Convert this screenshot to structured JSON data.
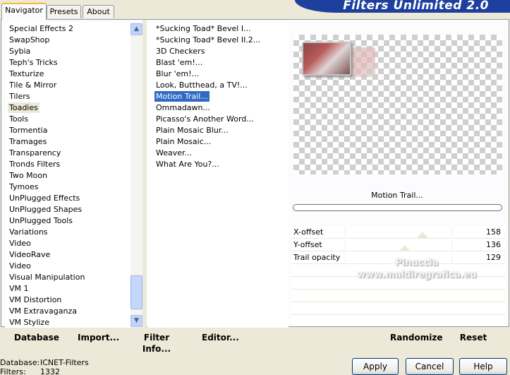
{
  "title": "Filters Unlimited 2.0",
  "tabs": [
    "Navigator",
    "Presets",
    "About"
  ],
  "categories": [
    "Special Effects 2",
    "SwapShop",
    "Sybia",
    "Teph's Tricks",
    "Texturize",
    "Tile & Mirror",
    "Tilers",
    "Toadies",
    "Tools",
    "Tormentia",
    "Tramages",
    "Transparency",
    "Tronds Filters",
    "Two Moon",
    "Tymoes",
    "UnPlugged Effects",
    "UnPlugged Shapes",
    "UnPlugged Tools",
    "Variations",
    "Video",
    "VideoRave",
    "Video",
    "Visual Manipulation",
    "VM 1",
    "VM Distortion",
    "VM Extravaganza",
    "VM Stylize"
  ],
  "selected_category": "Toadies",
  "filters": [
    "*Sucking Toad*  Bevel I...",
    "*Sucking Toad*  Bevel II.2...",
    "3D Checkers",
    "Blast 'em!...",
    "Blur 'em!...",
    "Look, Butthead, a TV!...",
    "Motion Trail...",
    "Ommadawn...",
    "Picasso's Another Word...",
    "Plain Mosaic Blur...",
    "Plain Mosaic...",
    "Weaver...",
    "What Are You?..."
  ],
  "selected_filter": "Motion Trail...",
  "filter_name": "Motion Trail...",
  "params": [
    {
      "label": "X-offset",
      "value": "158",
      "level": 158
    },
    {
      "label": "Y-offset",
      "value": "136",
      "level": 136
    },
    {
      "label": "Trail opacity",
      "value": "129",
      "level": 129
    }
  ],
  "watermark": [
    "Pinuccia",
    "www.maldiregrafica.eu"
  ],
  "bottom_buttons": [
    "Database",
    "Import...",
    "Filter Info...",
    "Editor...",
    "Randomize",
    "Reset"
  ],
  "status": {
    "database_label": "Database:",
    "database_value": "ICNET-Filters",
    "filters_label": "Filters:",
    "filters_value": "1332"
  },
  "dialog_buttons": [
    "Apply",
    "Cancel",
    "Help"
  ],
  "colors": {
    "banner": "#1d3f9d",
    "selection": "#316ac5",
    "tab_highlight": "#f6b93a"
  },
  "icons": {
    "scroll_up": "arrow-up-icon",
    "scroll_down": "arrow-down-icon"
  }
}
